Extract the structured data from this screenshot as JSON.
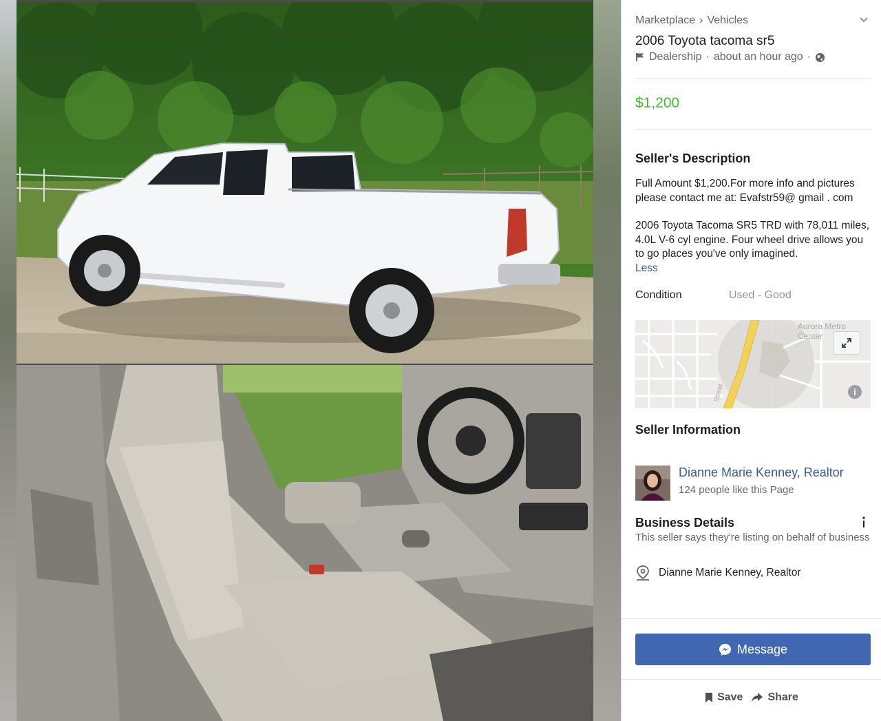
{
  "breadcrumb": {
    "parent": "Marketplace",
    "separator": "›",
    "current": "Vehicles"
  },
  "listing": {
    "title": "2006 Toyota tacoma sr5",
    "seller_type": "Dealership",
    "posted": "about an hour ago",
    "meta_separator": "·",
    "price": "$1,200",
    "price_color": "#42b72a"
  },
  "description": {
    "heading": "Seller's Description",
    "paragraph_1": "Full Amount $1,200.For more info and pictures please contact me at: Evafstr59@ gmail . com",
    "paragraph_2": "2006 Toyota Tacoma SR5 TRD with 78,011 miles, 4.0L V-6 cyl engine. Four wheel drive allows you to go places you've only imagined.",
    "less_link": "Less"
  },
  "condition": {
    "label": "Condition",
    "value": "Used - Good"
  },
  "map": {
    "place_label": "Aurora Metro Center",
    "street_label": "Street"
  },
  "seller": {
    "heading": "Seller Information",
    "name": "Dianne Marie Kenney, Realtor",
    "likes": "124 people like this Page"
  },
  "business": {
    "heading": "Business Details",
    "description": "This seller says they're listing on behalf of business",
    "owner": "Dianne Marie Kenney, Realtor"
  },
  "actions": {
    "message": "Message",
    "save": "Save",
    "share": "Share"
  },
  "colors": {
    "link": "#385898",
    "message_button": "#4267b2",
    "muted": "#606770"
  }
}
